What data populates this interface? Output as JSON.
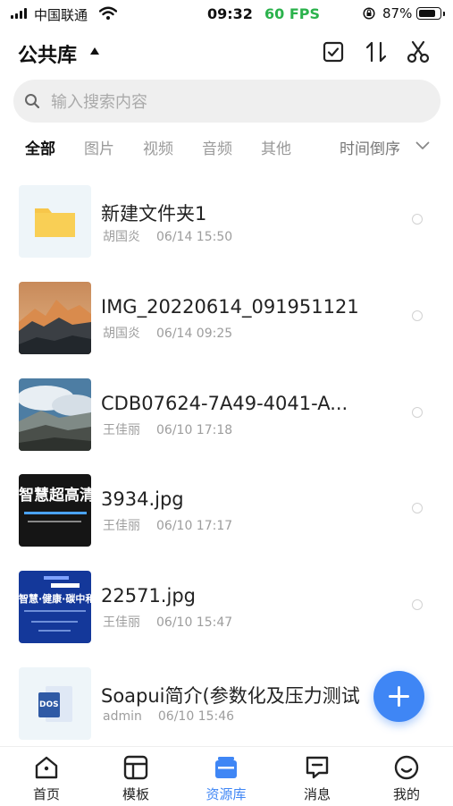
{
  "status_bar": {
    "carrier": "中国联通",
    "time": "09:32",
    "fps": "60 FPS",
    "battery": "87%",
    "battery_level": 0.87
  },
  "header": {
    "title": "公共库",
    "icons": [
      "select-checkbox-icon",
      "sort-icon",
      "scissors-icon"
    ]
  },
  "search": {
    "placeholder": "输入搜索内容"
  },
  "filters": {
    "tabs": [
      "全部",
      "图片",
      "视频",
      "音频",
      "其他"
    ],
    "active": "全部",
    "sort_label": "时间倒序"
  },
  "files": [
    {
      "name": "新建文件夹1",
      "owner": "胡国炎",
      "date": "06/14 15:50",
      "thumb": "folder-icon"
    },
    {
      "name": "IMG_20220614_091951121",
      "owner": "胡国炎",
      "date": "06/14 09:25",
      "thumb": "mountain-sunset-photo"
    },
    {
      "name": "CDB07624-7A49-4041-A...",
      "owner": "王佳丽",
      "date": "06/10 17:18",
      "thumb": "cloud-landscape-photo"
    },
    {
      "name": "3934.jpg",
      "owner": "王佳丽",
      "date": "06/10 17:17",
      "thumb": "banner-image",
      "thumb_text": "智慧超高清"
    },
    {
      "name": "22571.jpg",
      "owner": "王佳丽",
      "date": "06/10 15:47",
      "thumb": "forum-poster-image",
      "thumb_text": "智慧·健康·碳中和"
    },
    {
      "name": "Soapui简介(参数化及压力测试",
      "owner": "admin",
      "date": "06/10 15:46",
      "thumb": "doc-file-icon",
      "thumb_text": "DOS"
    }
  ],
  "nav": [
    {
      "label": "首页",
      "icon": "home-icon"
    },
    {
      "label": "模板",
      "icon": "template-icon"
    },
    {
      "label": "资源库",
      "icon": "library-icon"
    },
    {
      "label": "消息",
      "icon": "message-icon"
    },
    {
      "label": "我的",
      "icon": "profile-icon"
    }
  ],
  "nav_active": "资源库",
  "colors": {
    "accent": "#3f86f5",
    "fps": "#2bb24c",
    "folder": "#f7c64a"
  }
}
